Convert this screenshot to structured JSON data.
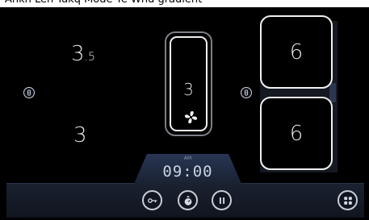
{
  "caption": "Ankh Leh Takq Mode Ye Wnd gradient",
  "zones": {
    "top_left": {
      "main": "3",
      "sub": ".5"
    },
    "bottom_left": {
      "value": "3"
    },
    "center": {
      "value": "3",
      "icon": "fan-icon"
    },
    "top_right": {
      "value": "6"
    },
    "bottom_right": {
      "value": "6"
    }
  },
  "timer": {
    "period": "AM",
    "time": "09:00"
  },
  "controls": {
    "lock": "key-icon",
    "timer": "stopwatch-icon",
    "pause": "pause-icon",
    "menu": "grid-menu-icon"
  },
  "colors": {
    "background": "#000000",
    "accent": "#283654",
    "zone_border": "#f0f0f0"
  }
}
